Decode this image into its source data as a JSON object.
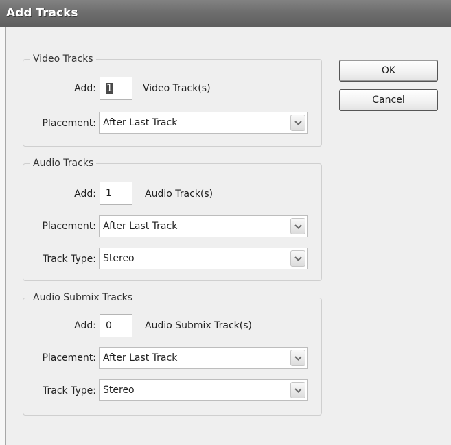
{
  "window": {
    "title": "Add Tracks"
  },
  "buttons": {
    "ok": "OK",
    "cancel": "Cancel"
  },
  "video": {
    "group_title": "Video Tracks",
    "add_label": "Add:",
    "add_value": "1",
    "unit_label": "Video Track(s)",
    "placement_label": "Placement:",
    "placement_value": "After Last Track"
  },
  "audio": {
    "group_title": "Audio Tracks",
    "add_label": "Add:",
    "add_value": "1",
    "unit_label": "Audio Track(s)",
    "placement_label": "Placement:",
    "placement_value": "After Last Track",
    "track_type_label": "Track Type:",
    "track_type_value": "Stereo"
  },
  "submix": {
    "group_title": "Audio Submix Tracks",
    "add_label": "Add:",
    "add_value": "0",
    "unit_label": "Audio Submix Track(s)",
    "placement_label": "Placement:",
    "placement_value": "After Last Track",
    "track_type_label": "Track Type:",
    "track_type_value": "Stereo"
  },
  "icons": {
    "dropdown": "chevron-down-icon"
  }
}
